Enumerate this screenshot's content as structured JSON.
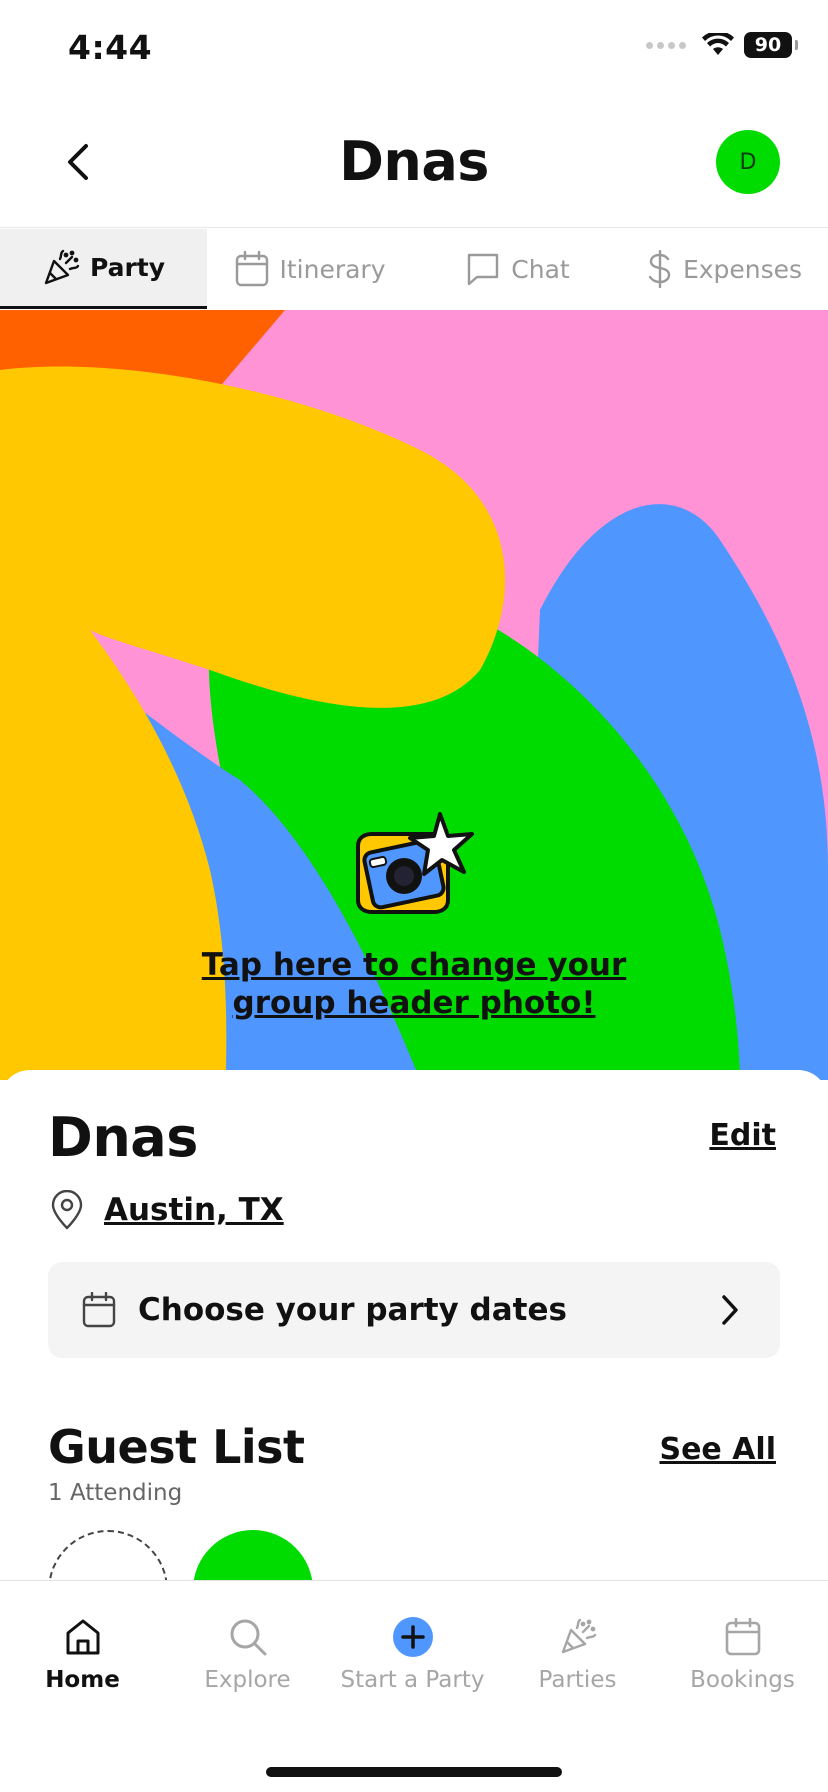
{
  "status": {
    "time": "4:44",
    "battery": "90"
  },
  "header": {
    "title": "Dnas",
    "avatar_initial": "D"
  },
  "tabs": [
    {
      "label": "Party",
      "icon": "party-popper-icon",
      "active": true
    },
    {
      "label": "Itinerary",
      "icon": "calendar-icon",
      "active": false
    },
    {
      "label": "Chat",
      "icon": "chat-bubble-icon",
      "active": false
    },
    {
      "label": "Expenses",
      "icon": "dollar-icon",
      "active": false
    }
  ],
  "hero": {
    "cta": "Tap here to change your group header photo!"
  },
  "party": {
    "name": "Dnas",
    "edit_label": "Edit",
    "location": "Austin, TX",
    "dates_prompt": "Choose your party dates"
  },
  "guests": {
    "title": "Guest List",
    "see_all": "See All",
    "attending": "1 Attending"
  },
  "bottom_nav": [
    {
      "label": "Home",
      "icon": "home-icon",
      "active": true
    },
    {
      "label": "Explore",
      "icon": "search-icon",
      "active": false
    },
    {
      "label": "Start a Party",
      "icon": "plus-circle-icon",
      "active": false
    },
    {
      "label": "Parties",
      "icon": "party-popper-icon",
      "active": false
    },
    {
      "label": "Bookings",
      "icon": "calendar-icon",
      "active": false
    }
  ],
  "colors": {
    "accent_green": "#00dc00",
    "accent_blue": "#4f96ff",
    "pink": "#ff93d6",
    "yellow": "#ffc800",
    "orange": "#ff6000"
  }
}
